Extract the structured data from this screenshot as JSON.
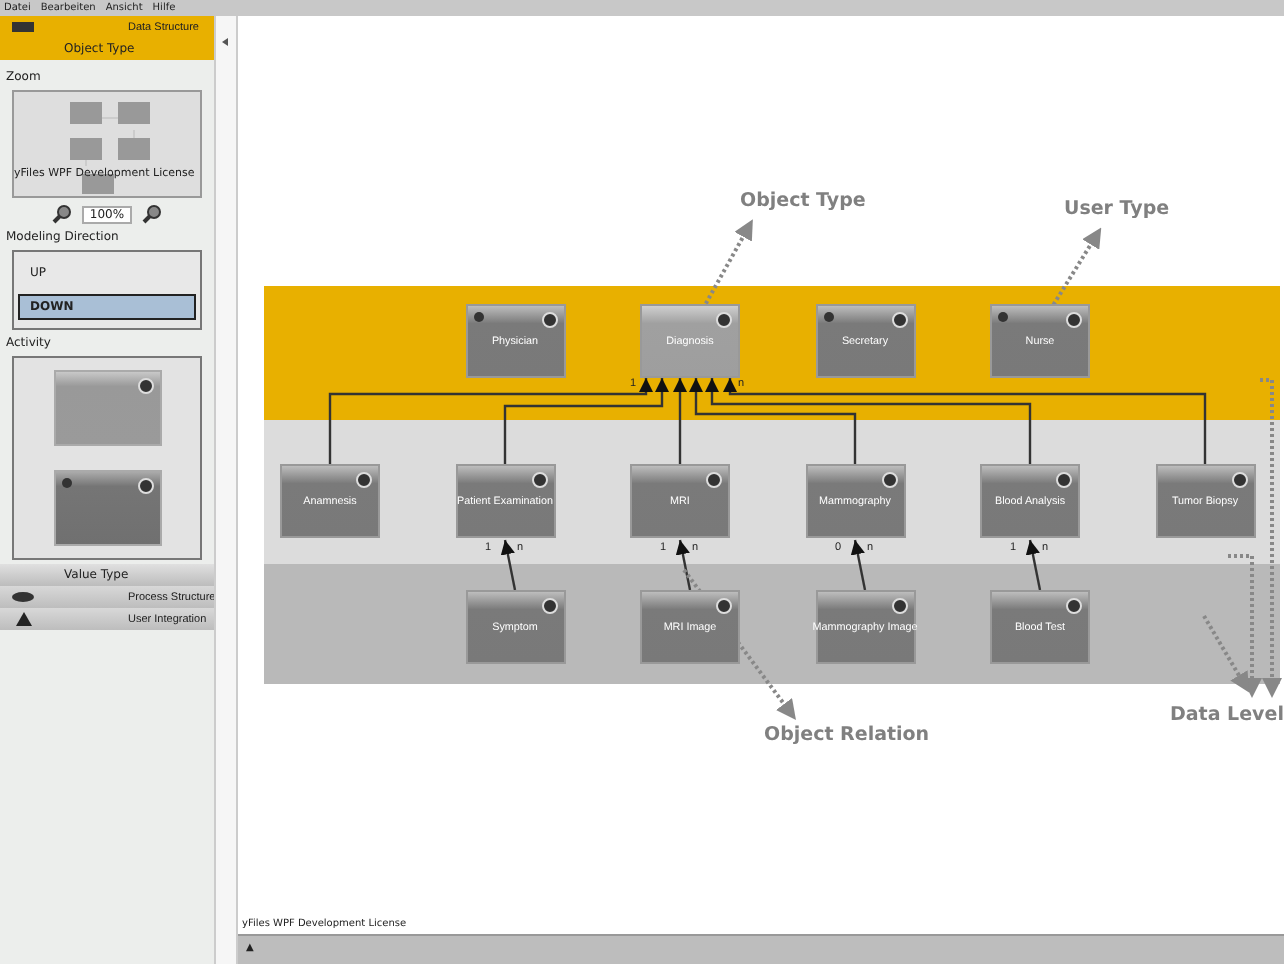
{
  "menu": [
    "Datei",
    "Bearbeiten",
    "Ansicht",
    "Hilfe"
  ],
  "sidebar": {
    "sections": [
      {
        "label": "Data Structure",
        "selected": true,
        "children": [
          {
            "label": "Object Type",
            "selected": true
          },
          {
            "label": "Value Type",
            "selected": false
          }
        ]
      },
      {
        "label": "Process Structure",
        "selected": false
      },
      {
        "label": "User Integration",
        "selected": false
      }
    ]
  },
  "panel": {
    "zoom_label": "Zoom",
    "preview_license": "yFiles WPF Development License",
    "zoom_value": "100%",
    "direction_label": "Modeling Direction",
    "directions": [
      {
        "label": "UP",
        "selected": false
      },
      {
        "label": "DOWN",
        "selected": true
      }
    ],
    "activity_label": "Activity",
    "activities": [
      {
        "kind": "plain"
      },
      {
        "kind": "user"
      }
    ]
  },
  "diagram": {
    "levels": [
      {
        "color": "#e8b000",
        "nodes": [
          {
            "label": "Physician",
            "user_icon": true,
            "selected": false
          },
          {
            "label": "Diagnosis",
            "user_icon": false,
            "selected": true
          },
          {
            "label": "Secretary",
            "user_icon": true,
            "selected": false
          },
          {
            "label": "Nurse",
            "user_icon": true,
            "selected": false
          }
        ]
      },
      {
        "color": "#dcdcdc",
        "nodes": [
          {
            "label": "Anamnesis",
            "user_icon": false,
            "selected": false
          },
          {
            "label": "Patient Examination",
            "user_icon": false,
            "selected": false
          },
          {
            "label": "MRI",
            "user_icon": false,
            "selected": false
          },
          {
            "label": "Mammography",
            "user_icon": false,
            "selected": false
          },
          {
            "label": "Blood Analysis",
            "user_icon": false,
            "selected": false
          },
          {
            "label": "Tumor Biopsy",
            "user_icon": false,
            "selected": false
          }
        ]
      },
      {
        "color": "#b9b9b9",
        "nodes": [
          {
            "label": "Symptom",
            "user_icon": false,
            "selected": false
          },
          {
            "label": "MRI Image",
            "user_icon": false,
            "selected": false
          },
          {
            "label": "Mammography Image",
            "user_icon": false,
            "selected": false
          },
          {
            "label": "Blood Test",
            "user_icon": false,
            "selected": false
          }
        ]
      }
    ],
    "top_multiplicity": {
      "from": "1",
      "to": "n"
    },
    "relations": [
      {
        "from_label": "1",
        "to_label": "n"
      },
      {
        "from_label": "1",
        "to_label": "n"
      },
      {
        "from_label": "0",
        "to_label": "n"
      },
      {
        "from_label": "1",
        "to_label": "n"
      }
    ],
    "annotations": [
      "Object Type",
      "User Type",
      "Object Relation",
      "Data Level"
    ],
    "license": "yFiles WPF Development License"
  },
  "status_bar": {
    "toggle": "▲"
  }
}
